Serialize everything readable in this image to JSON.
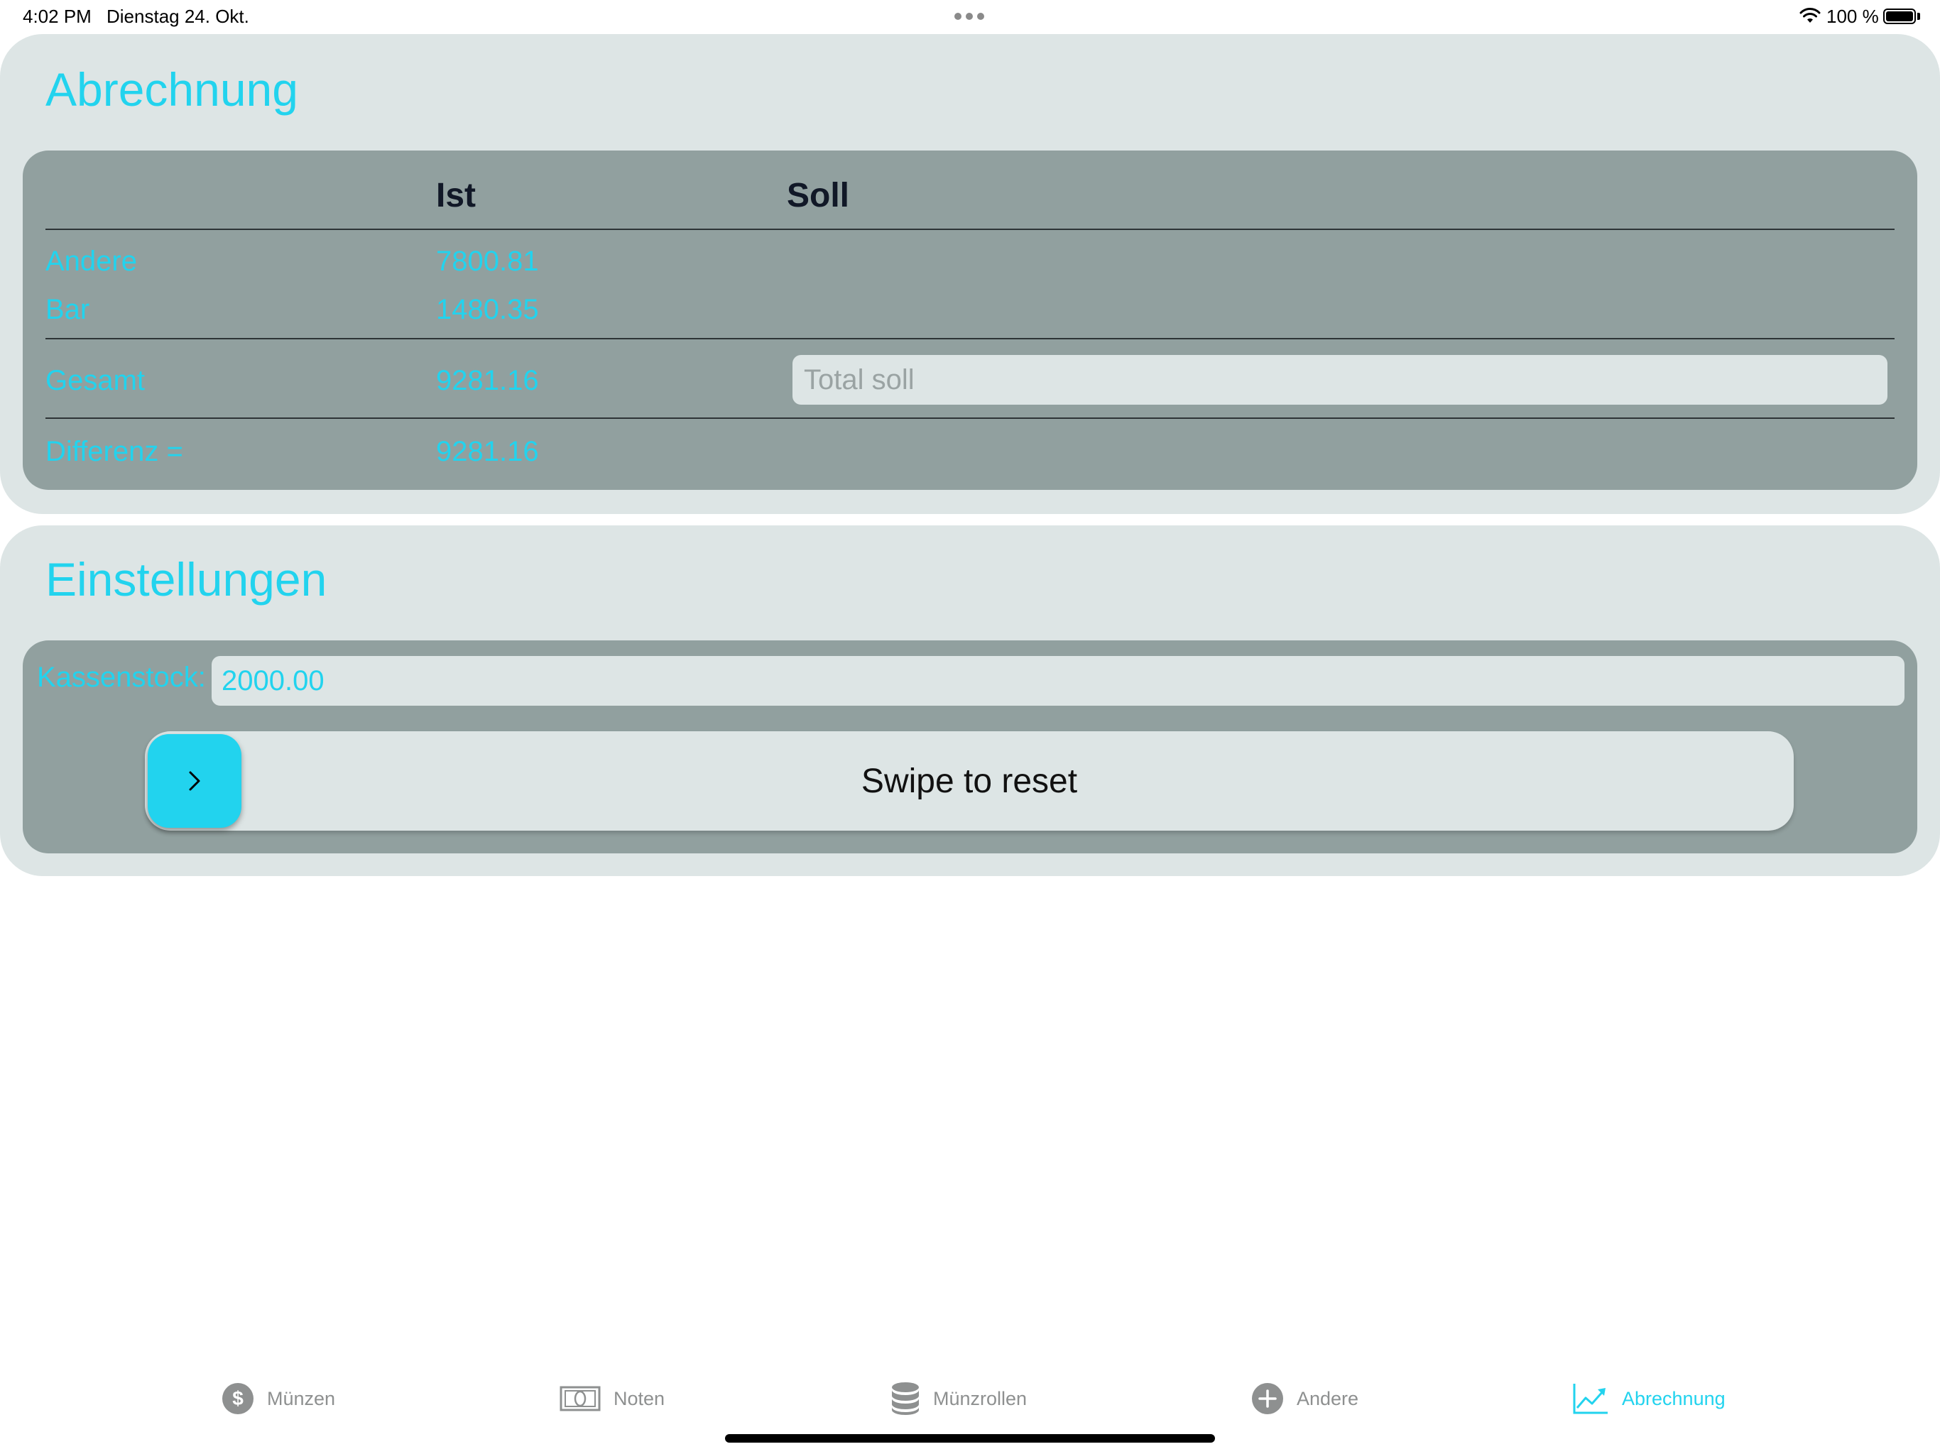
{
  "status_bar": {
    "time": "4:02 PM",
    "date": "Dienstag 24. Okt.",
    "battery": "100 %"
  },
  "abrechnung": {
    "title": "Abrechnung",
    "col_ist": "Ist",
    "col_soll": "Soll",
    "rows": [
      {
        "label": "Andere",
        "ist": "7800.81"
      },
      {
        "label": "Bar",
        "ist": "1480.35"
      }
    ],
    "total": {
      "label": "Gesamt",
      "ist": "9281.16",
      "soll_placeholder": "Total soll"
    },
    "difference": {
      "label": "Differenz =",
      "value": "9281.16"
    }
  },
  "einstellungen": {
    "title": "Einstellungen",
    "kassenstock_label": "Kassenstock:",
    "kassenstock_value": "2000.00",
    "swipe_label": "Swipe to reset"
  },
  "tabs": [
    {
      "label": "Münzen",
      "icon": "dollar-circle-icon",
      "active": false
    },
    {
      "label": "Noten",
      "icon": "banknote-icon",
      "active": false
    },
    {
      "label": "Münzrollen",
      "icon": "coin-stack-icon",
      "active": false
    },
    {
      "label": "Andere",
      "icon": "plus-circle-icon",
      "active": false
    },
    {
      "label": "Abrechnung",
      "icon": "chart-line-icon",
      "active": true
    }
  ],
  "colors": {
    "accent": "#22d3ee",
    "card_bg": "#dde5e5",
    "inner_bg": "#91a09f",
    "tab_inactive": "#8e9090"
  }
}
